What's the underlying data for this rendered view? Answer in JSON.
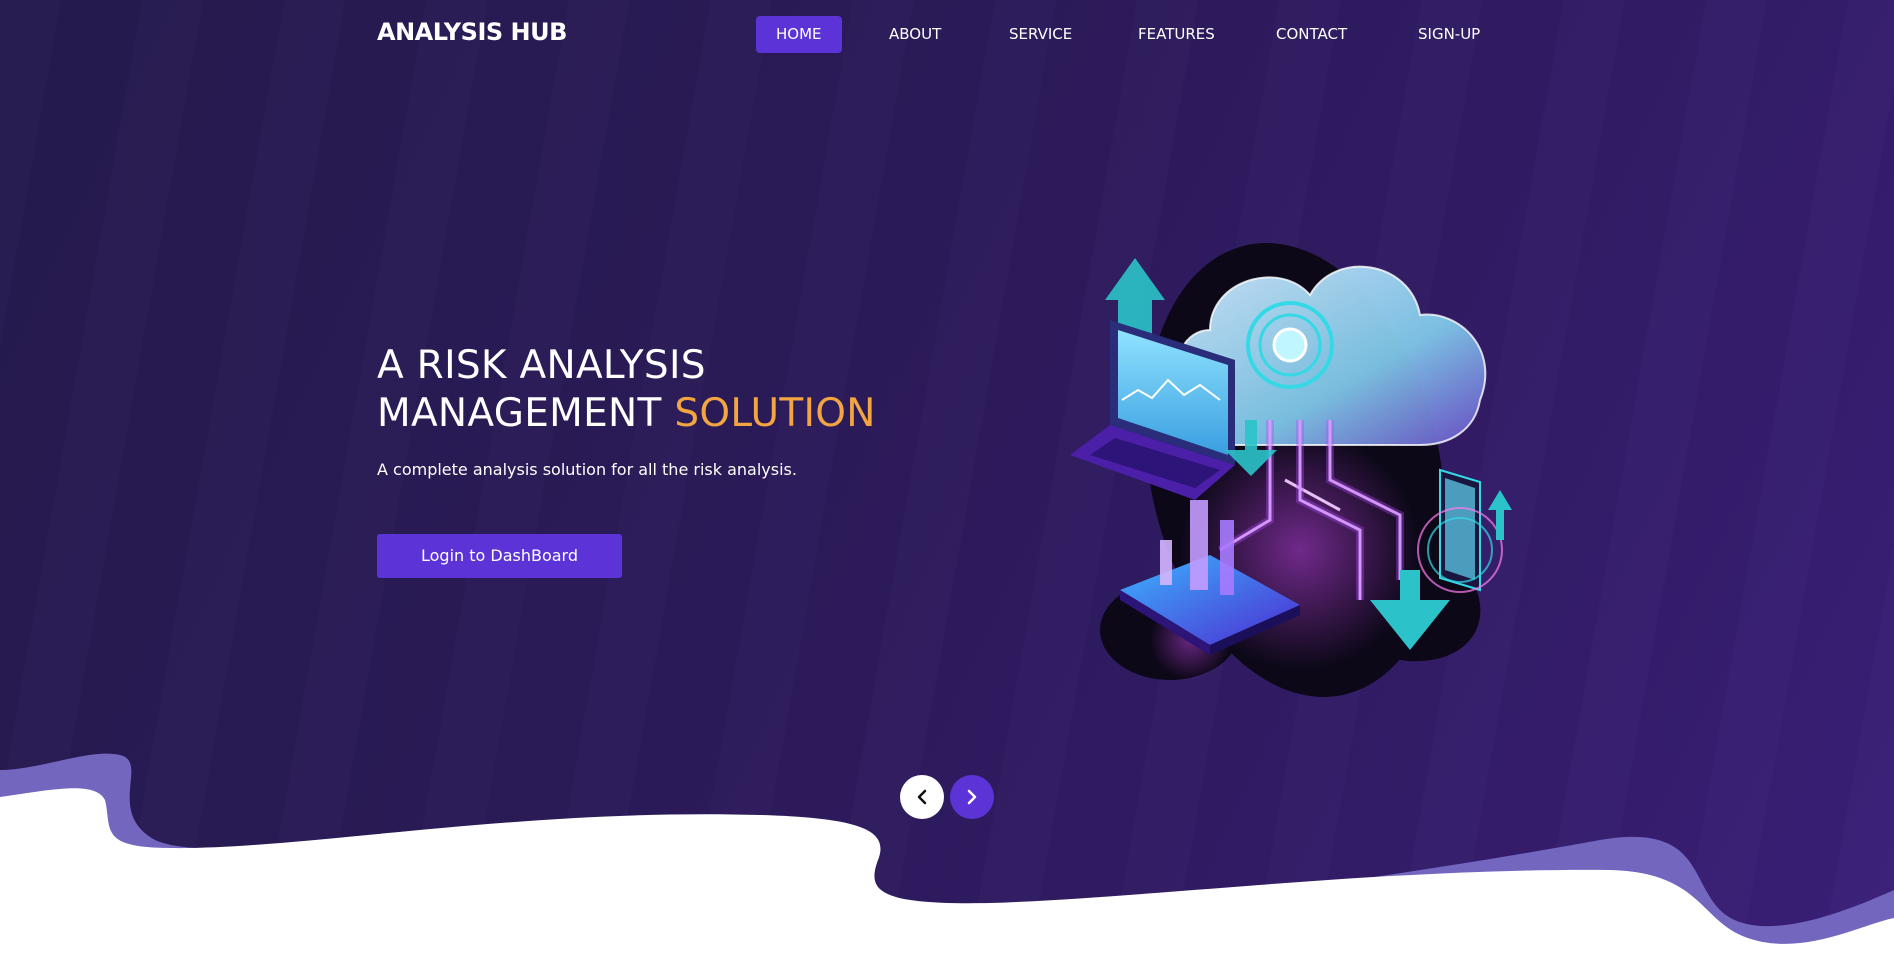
{
  "header": {
    "brand": "ANALYSIS HUB"
  },
  "nav": {
    "items": [
      {
        "label": "HOME",
        "active": true
      },
      {
        "label": "ABOUT",
        "active": false
      },
      {
        "label": "SERVICE",
        "active": false
      },
      {
        "label": "FEATURES",
        "active": false
      },
      {
        "label": "CONTACT",
        "active": false
      },
      {
        "label": "SIGN-UP",
        "active": false
      }
    ]
  },
  "hero": {
    "headline_line1": "A RISK ANALYSIS",
    "headline_line2": "MANAGEMENT ",
    "headline_accent": "SOLUTION",
    "subtitle": "A complete analysis solution for all the risk analysis.",
    "cta_label": "Login to DashBoard",
    "illustration": "isometric-cloud-data-illustration"
  },
  "slider": {
    "prev_icon": "chevron-left-icon",
    "next_icon": "chevron-right-icon"
  },
  "colors": {
    "background_dark": "#2b1a58",
    "accent_purple": "#5b33d6",
    "accent_orange": "#f2a541",
    "wave_band": "#7266bf",
    "text": "#ffffff"
  }
}
